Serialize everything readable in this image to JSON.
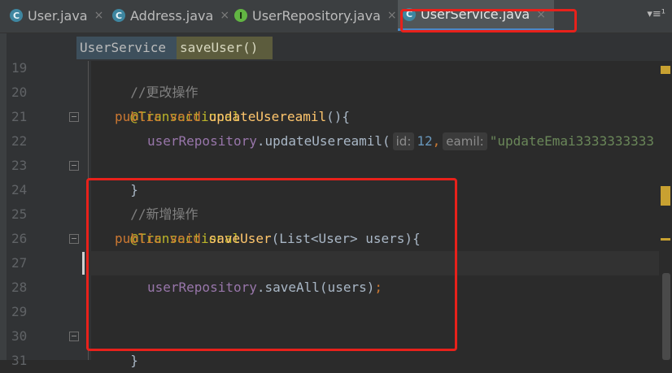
{
  "tabs": [
    {
      "label": "User.java",
      "icon": "c-icon",
      "close": "×"
    },
    {
      "label": "Address.java",
      "icon": "c-icon",
      "close": "×"
    },
    {
      "label": "UserRepository.java",
      "icon": "i-icon",
      "close": "×"
    },
    {
      "label": "UserService.java",
      "icon": "c-icon",
      "close": "×"
    }
  ],
  "tab_icon_letters": {
    "c": "C",
    "i": "I"
  },
  "tab_menu": "▾≡¹",
  "breadcrumb": {
    "class_name": "UserService",
    "method_name": "saveUser()"
  },
  "line_numbers": [
    "19",
    "20",
    "21",
    "22",
    "23",
    "24",
    "25",
    "26",
    "27",
    "28",
    "29",
    "30",
    "31"
  ],
  "code": {
    "l19": "//更改操作",
    "l20": "@Transactional",
    "l21_kw1": "public",
    "l21_kw2": "void",
    "l21_fn": "updateUsereamil",
    "l21_rest": "(){",
    "l22_field": "userRepository",
    "l22_call": ".updateUsereamil(",
    "l22_hint1": "id:",
    "l22_num": "12",
    "l22_comma": ",",
    "l22_hint2": "eamil:",
    "l22_str": "\"updateEmai3333333333",
    "l23": "}",
    "l24": "//新增操作",
    "l25": "@Transactional",
    "l26_kw1": "public",
    "l26_kw2": "void",
    "l26_fn": "saveUser",
    "l26_rest": "(List<User> users){",
    "l28_field": "userRepository",
    "l28_call": ".saveAll(users)",
    "l28_semi": ";",
    "l30": "}"
  },
  "colors": {
    "highlight_box": "#e8211b",
    "keyword": "#cc7832",
    "annotation": "#bbb529",
    "field": "#9876aa",
    "method": "#ffc66d",
    "string": "#6a8759",
    "number": "#6897bb"
  }
}
